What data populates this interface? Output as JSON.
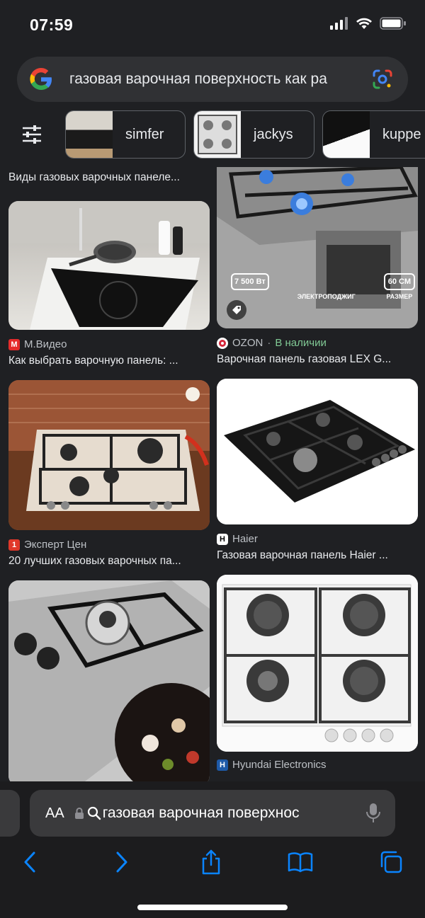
{
  "status": {
    "time": "07:59"
  },
  "search": {
    "query": "газовая варочная поверхность как ра"
  },
  "chips": [
    {
      "label": "simfer"
    },
    {
      "label": "jackys"
    },
    {
      "label": "kuppe"
    }
  ],
  "results": {
    "top_caption": "Виды газовых варочных панеле...",
    "left": [
      {
        "source": "М.Видео",
        "title": "Как выбрать варочную панель: ..."
      },
      {
        "source": "Эксперт Цен",
        "title": "20 лучших газовых варочных па..."
      },
      {
        "source": "",
        "title": ""
      }
    ],
    "right": [
      {
        "source": "OZON",
        "availability": "В наличии",
        "title": "Варочная панель газовая LEX G...",
        "badges": [
          "7 500 Вт",
          "ЭЛЕКТРОПОДЖИГ",
          "60 СМ",
          "РАЗМЕР"
        ]
      },
      {
        "source": "Haier",
        "title": "Газовая варочная панель Haier ..."
      },
      {
        "source": "Hyundai Electronics",
        "title": ""
      }
    ]
  },
  "browser": {
    "aa_label": "AA",
    "url_text": "газовая варочная поверхнос"
  },
  "icons": {
    "back": "chevron-left-icon",
    "forward": "chevron-right-icon",
    "share": "share-icon",
    "bookmarks": "book-icon",
    "tabs": "tabs-icon"
  },
  "colors": {
    "accent": "#0a84ff",
    "background": "#1f2023"
  }
}
